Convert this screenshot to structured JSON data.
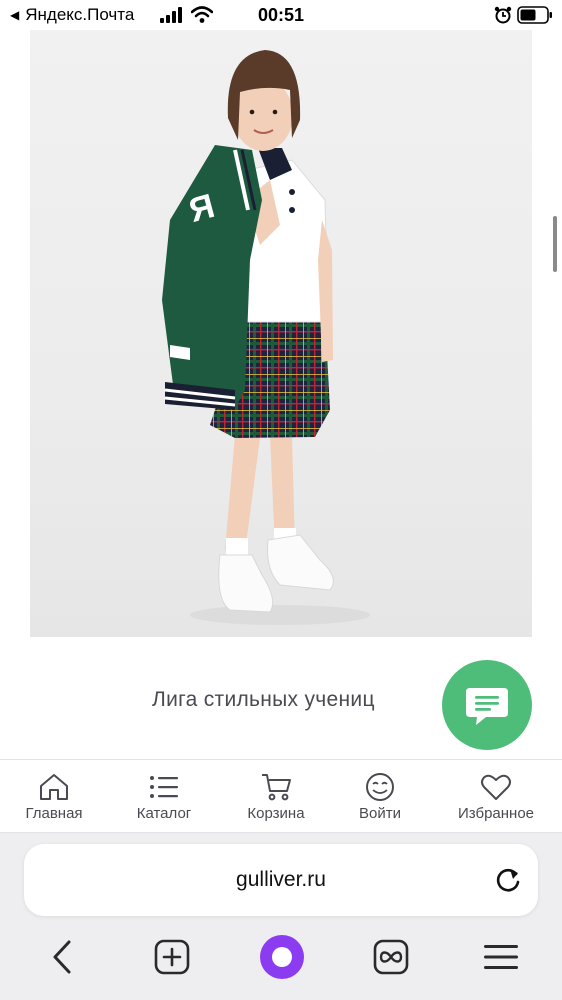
{
  "status_bar": {
    "back_app": "Яндекс.Почта",
    "time": "00:51"
  },
  "product": {
    "image_alt": "Фото товара",
    "caption": "Лига стильных учениц"
  },
  "site_nav": {
    "items": [
      {
        "label": "Главная",
        "icon": "home-icon"
      },
      {
        "label": "Каталог",
        "icon": "catalog-list-icon"
      },
      {
        "label": "Корзина",
        "icon": "cart-icon"
      },
      {
        "label": "Войти",
        "icon": "smile-login-icon"
      },
      {
        "label": "Избранное",
        "icon": "heart-icon"
      }
    ]
  },
  "browser": {
    "url": "gulliver.ru",
    "buttons": [
      "back-arrow-icon",
      "new-tab-plus-icon",
      "alice-assistant-icon",
      "tabs-infinity-icon",
      "menu-hamburger-icon"
    ]
  },
  "colors": {
    "accent_green": "#4fbd7a",
    "alice_purple": "#8c3cf0",
    "text_gray": "#4a4a52",
    "browser_bg": "#eeeef0"
  }
}
